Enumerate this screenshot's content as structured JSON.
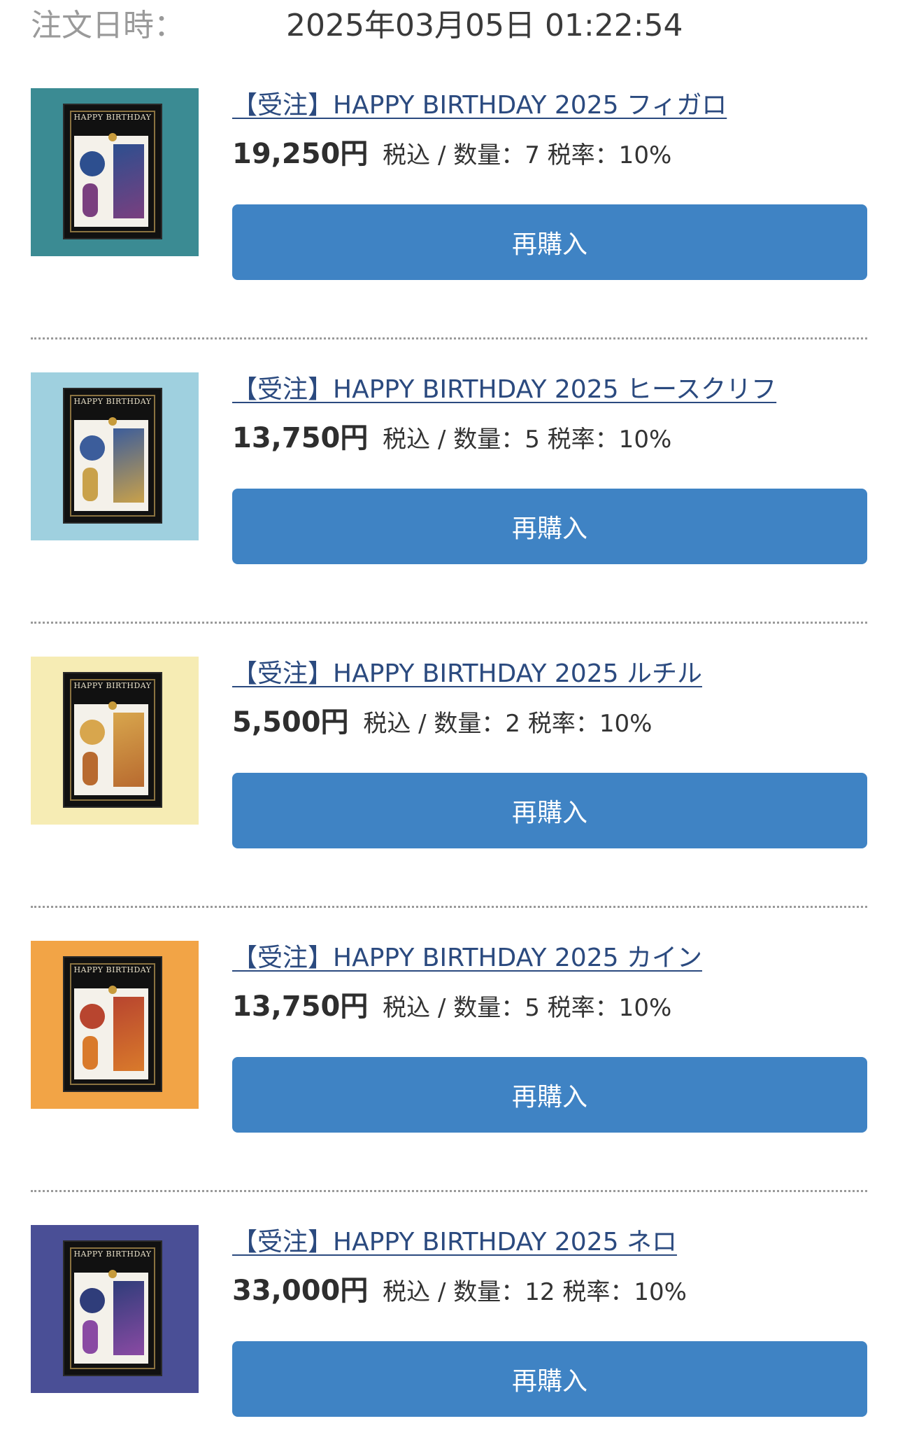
{
  "order": {
    "label": "注文日時：",
    "datetime": "2025年03月05日 01:22:54"
  },
  "colors": {
    "button": "#3f83c4",
    "link": "#2b4a7f"
  },
  "icons": {
    "product_image": "product-thumbnail"
  },
  "items": [
    {
      "title": "【受注】HAPPY BIRTHDAY 2025 フィガロ",
      "price": "19,250円",
      "detail": "税込 / 数量：7 税率：10%",
      "button": "再購入",
      "thumb_bg": "#3b8b93",
      "accent": "#2d4f8f",
      "accent2": "#7a3f7f"
    },
    {
      "title": "【受注】HAPPY BIRTHDAY 2025 ヒースクリフ",
      "price": "13,750円",
      "detail": "税込 / 数量：5 税率：10%",
      "button": "再購入",
      "thumb_bg": "#9fd0df",
      "accent": "#3c5d9b",
      "accent2": "#c9a14a"
    },
    {
      "title": "【受注】HAPPY BIRTHDAY 2025 ルチル",
      "price": "5,500円",
      "detail": "税込 / 数量：2 税率：10%",
      "button": "再購入",
      "thumb_bg": "#f6ecb4",
      "accent": "#d8a64d",
      "accent2": "#b86a2f"
    },
    {
      "title": "【受注】HAPPY BIRTHDAY 2025 カイン",
      "price": "13,750円",
      "detail": "税込 / 数量：5 税率：10%",
      "button": "再購入",
      "thumb_bg": "#f2a446",
      "accent": "#b8452f",
      "accent2": "#d97a2b"
    },
    {
      "title": "【受注】HAPPY BIRTHDAY 2025 ネロ",
      "price": "33,000円",
      "detail": "税込 / 数量：12 税率：10%",
      "button": "再購入",
      "thumb_bg": "#4a4f96",
      "accent": "#2f3d7a",
      "accent2": "#8a4aa3"
    }
  ],
  "thumb_text": "HAPPY BIRTHDAY"
}
